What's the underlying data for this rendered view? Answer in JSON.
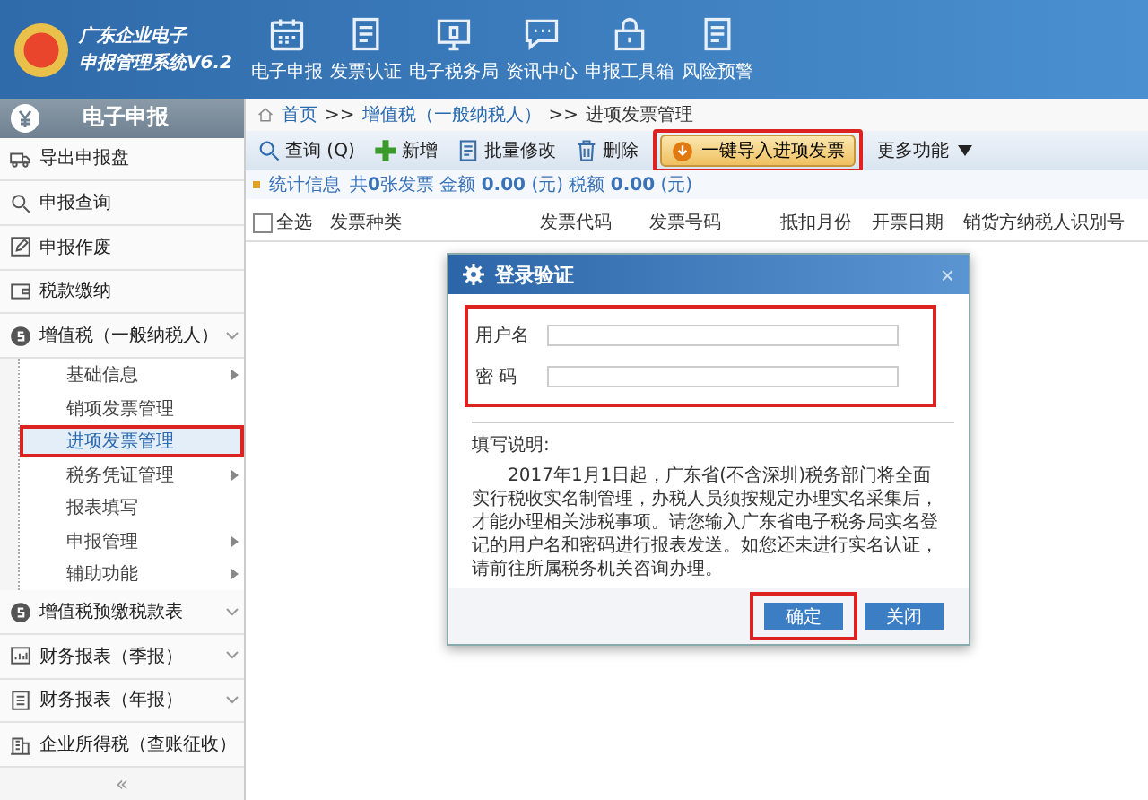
{
  "app": {
    "title_line1": "广东企业电子",
    "title_line2": "申报管理系统V6.2"
  },
  "nav": [
    "电子申报",
    "发票认证",
    "电子税务局",
    "资讯中心",
    "申报工具箱",
    "风险预警"
  ],
  "sidebar": {
    "title": "电子申报",
    "items": [
      {
        "label": "导出申报盘"
      },
      {
        "label": "申报查询"
      },
      {
        "label": "申报作废"
      },
      {
        "label": "税款缴纳"
      },
      {
        "label": "增值税（一般纳税人）",
        "children": [
          {
            "label": "基础信息",
            "has_submenu": true,
            "selected": false
          },
          {
            "label": "销项发票管理",
            "has_submenu": false,
            "selected": false
          },
          {
            "label": "进项发票管理",
            "has_submenu": false,
            "selected": true
          },
          {
            "label": "税务凭证管理",
            "has_submenu": true,
            "selected": false
          },
          {
            "label": "报表填写",
            "has_submenu": false,
            "selected": false
          },
          {
            "label": "申报管理",
            "has_submenu": true,
            "selected": false
          },
          {
            "label": "辅助功能",
            "has_submenu": true,
            "selected": false
          }
        ]
      },
      {
        "label": "增值税预缴税款表"
      },
      {
        "label": "财务报表（季报）"
      },
      {
        "label": "财务报表（年报）"
      },
      {
        "label": "企业所得税（查账征收）"
      }
    ],
    "collapse": "«"
  },
  "breadcrumb": [
    "首页",
    ">>",
    "增值税（一般纳税人）",
    ">>",
    "进项发票管理"
  ],
  "toolbar": [
    {
      "label": "查询 (Q)",
      "kind": "tool",
      "highlighted": false
    },
    {
      "label": "新增",
      "kind": "tool",
      "highlighted": false
    },
    {
      "label": "批量修改",
      "kind": "tool",
      "highlighted": false
    },
    {
      "label": "删除",
      "kind": "tool",
      "highlighted": false
    },
    {
      "label": "一键导入进项发票",
      "kind": "primary",
      "highlighted": true
    },
    {
      "label": "更多功能",
      "kind": "menu",
      "highlighted": false
    }
  ],
  "stats": {
    "label": "统计信息",
    "text": "共**0**张发票 金额 **0.00** (元) 税额 **0.00** (元)"
  },
  "table": {
    "select_all": {
      "label": "全选",
      "checked": false
    },
    "columns": [
      "发票种类",
      "发票代码",
      "发票号码",
      "抵扣月份",
      "开票日期",
      "销货方纳税人识别号"
    ]
  },
  "dialog": {
    "title": "登录验证",
    "close": "×",
    "fields_highlighted": true,
    "fields": [
      {
        "label": "用户名"
      },
      {
        "label": "密 码"
      }
    ],
    "notes_title": "填写说明:",
    "notes": "2017年1月1日起，广东省(不含深圳)税务部门将全面实行税收实名制管理，办税人员须按规定办理实名采集后，才能办理相关涉税事项。请您输入广东省电子税务局实名登记的用户名和密码进行报表发送。如您还未进行实名认证，请前往所属税务机关咨询办理。",
    "buttons": [
      {
        "label": "确定",
        "highlighted": true
      },
      {
        "label": "关闭",
        "highlighted": false
      }
    ]
  }
}
